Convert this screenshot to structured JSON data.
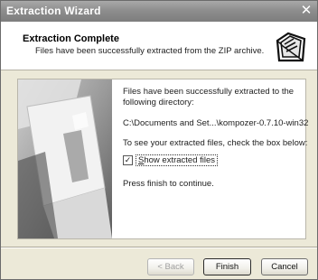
{
  "window": {
    "title": "Extraction Wizard",
    "close_glyph": "✕"
  },
  "header": {
    "title": "Extraction Complete",
    "subtitle": "Files have been successfully extracted from the ZIP archive.",
    "icon": "zip-folder-icon"
  },
  "content": {
    "message": "Files have been successfully extracted to the following directory:",
    "path": "C:\\Documents and Set...\\kompozer-0.7.10-win32",
    "checkbox_prompt": "To see your extracted files, check the box below:",
    "checkbox": {
      "label_mnemonic": "S",
      "label_rest": "how extracted files",
      "checked": true,
      "check_glyph": "✓"
    },
    "finish_prompt": "Press finish to continue."
  },
  "buttons": {
    "back": "< Back",
    "finish": "Finish",
    "cancel": "Cancel"
  },
  "colors": {
    "titlebar": "#8e8e8e",
    "dialog_bg": "#ece9d8",
    "panel_bg": "#ffffff"
  }
}
